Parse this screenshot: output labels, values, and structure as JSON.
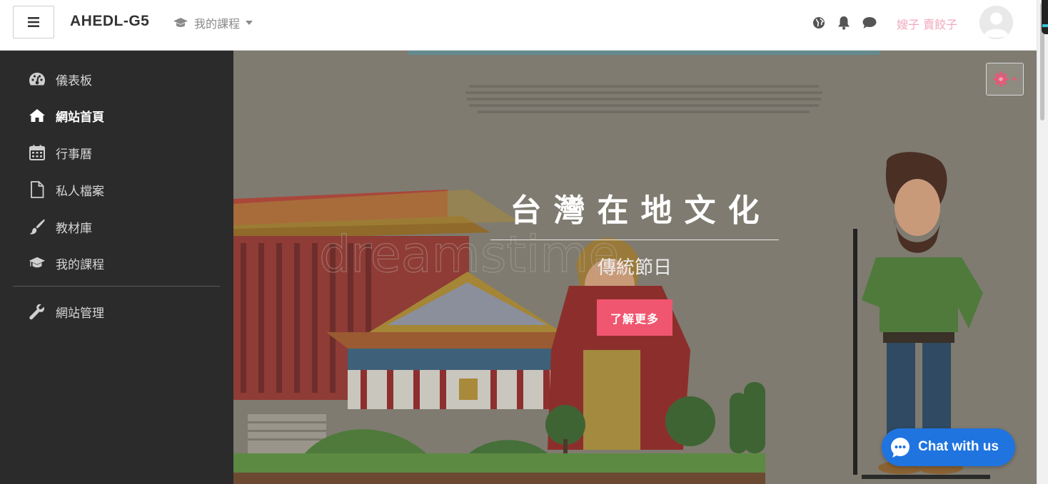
{
  "navbar": {
    "site_name": "AHEDL-G5",
    "my_courses_label": "我的課程",
    "user_name": "嫂子 賣餃子",
    "icons": [
      "globe-icon",
      "bell-icon",
      "chat-bubble-icon",
      "chevron-down-icon"
    ]
  },
  "sidebar": {
    "items": [
      {
        "label": "儀表板",
        "icon": "dashboard-icon"
      },
      {
        "label": "網站首頁",
        "icon": "home-icon",
        "active": true
      },
      {
        "label": "行事曆",
        "icon": "calendar-icon"
      },
      {
        "label": "私人檔案",
        "icon": "file-icon"
      },
      {
        "label": "教材庫",
        "icon": "brush-icon"
      },
      {
        "label": "我的課程",
        "icon": "graduation-cap-icon"
      },
      {
        "label": "網站管理",
        "icon": "wrench-icon"
      }
    ]
  },
  "hero": {
    "title": "台灣在地文化",
    "subtitle": "傳統節日",
    "button_label": "了解更多",
    "settings_icon": "gear-icon"
  },
  "chat_widget": {
    "label": "Chat with us",
    "icon": "chat-bubble-icon"
  },
  "colors": {
    "sidebar_bg": "#2b2b2b",
    "accent": "#f0566f",
    "chat_blue": "#1f74e0",
    "user_name": "#f2a7bc"
  }
}
